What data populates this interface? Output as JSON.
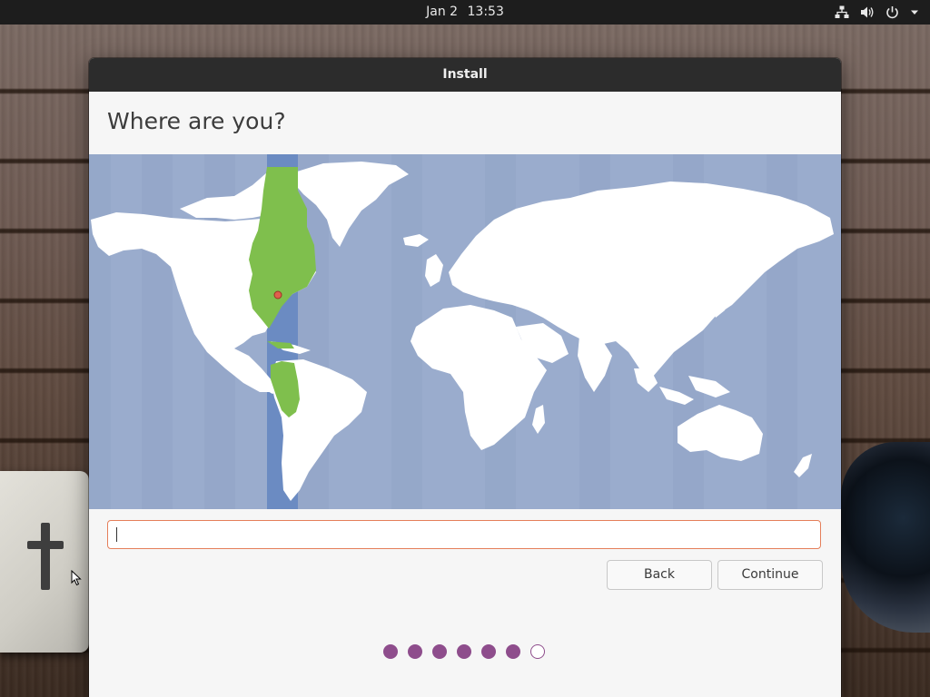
{
  "topbar": {
    "date": "Jan 2",
    "time": "13:53",
    "tray_icons": [
      "network-icon",
      "volume-icon",
      "power-icon",
      "system-menu-arrow-icon"
    ]
  },
  "window": {
    "title": "Install",
    "heading": "Where are you?"
  },
  "map": {
    "ocean_color": "#9aaccd",
    "land_color": "#ffffff",
    "selected_zone_color": "#7fbf4d",
    "selected_band_color": "#6b8bc2",
    "marker_color": "#e0604d"
  },
  "timezone_input": {
    "value": "",
    "placeholder": ""
  },
  "buttons": {
    "back_label": "Back",
    "continue_label": "Continue"
  },
  "progress": {
    "total_steps": 7,
    "completed_steps": 6,
    "accent_color": "#8e4d8c"
  }
}
